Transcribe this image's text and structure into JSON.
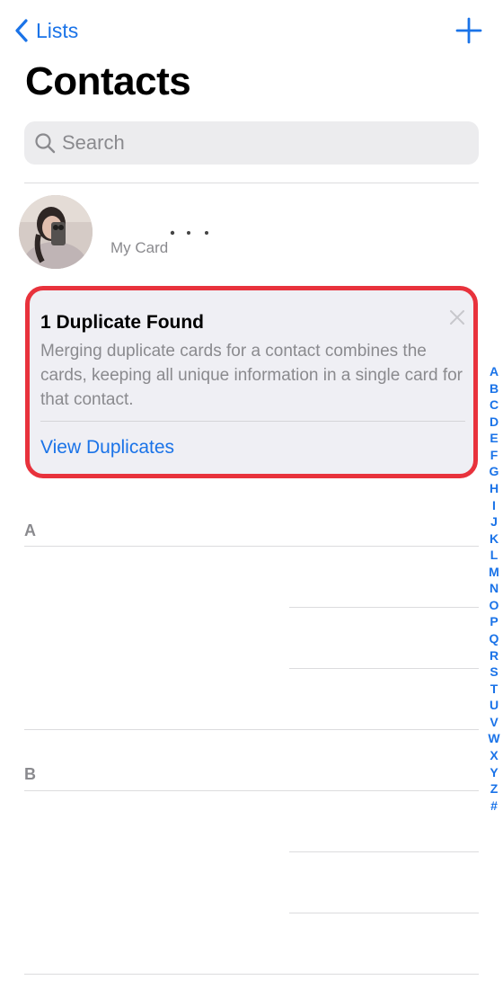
{
  "nav": {
    "back_label": "Lists",
    "add_icon": "plus-icon"
  },
  "page": {
    "title": "Contacts"
  },
  "search": {
    "placeholder": "Search",
    "icon": "search-icon"
  },
  "my_card": {
    "label": "My Card"
  },
  "duplicate_banner": {
    "title": "1 Duplicate Found",
    "body": "Merging duplicate cards for a contact combines the cards, keeping all unique information in a single card for that contact.",
    "action": "View Duplicates",
    "border_color": "#e8323c"
  },
  "sections": [
    {
      "letter": "A"
    },
    {
      "letter": "B"
    }
  ],
  "index_letters": [
    "A",
    "B",
    "C",
    "D",
    "E",
    "F",
    "G",
    "H",
    "I",
    "J",
    "K",
    "L",
    "M",
    "N",
    "O",
    "P",
    "Q",
    "R",
    "S",
    "T",
    "U",
    "V",
    "W",
    "X",
    "Y",
    "Z",
    "#"
  ],
  "colors": {
    "accent": "#1a73e8",
    "secondary_text": "#8a8a8e",
    "highlight_border": "#e8323c"
  }
}
